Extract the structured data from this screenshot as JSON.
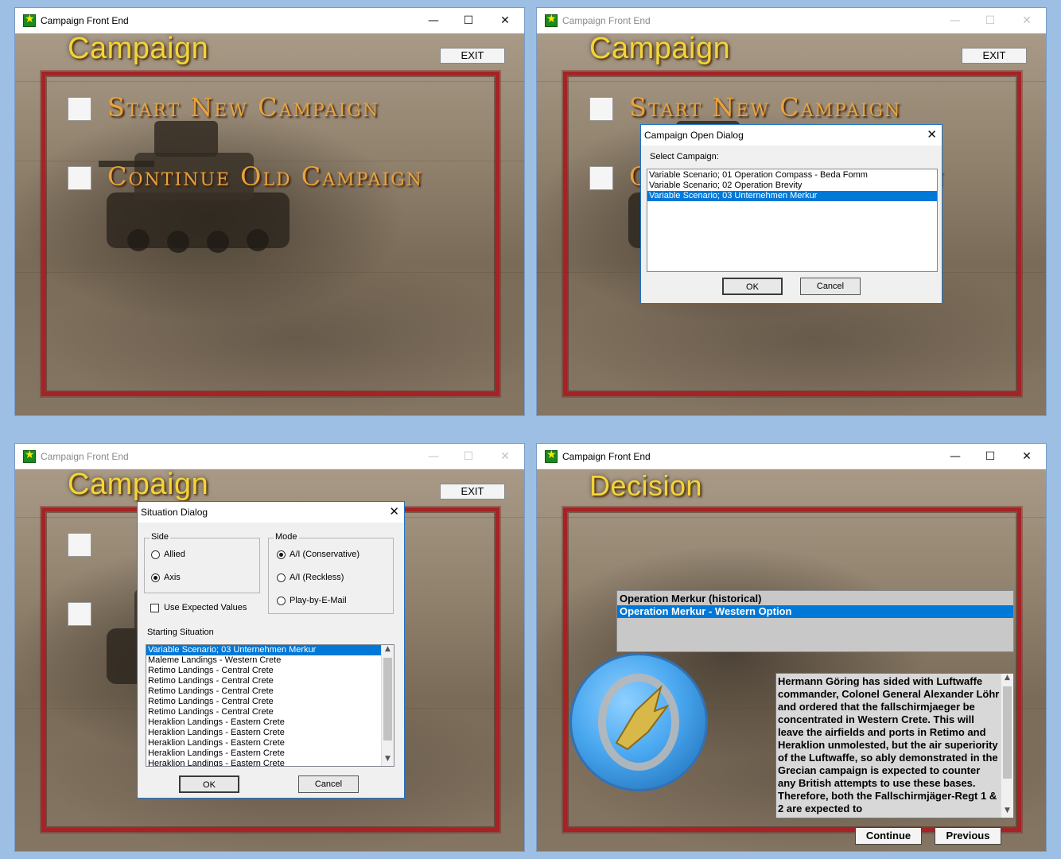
{
  "window_title": "Campaign Front End",
  "window_controls": {
    "minimize": "—",
    "maximize": "☐",
    "close": "✕"
  },
  "icons": {
    "app": "star-app-icon",
    "close": "close-icon"
  },
  "colors": {
    "heading": "#f3d43a",
    "menu_text": "#e8a33c",
    "frame": "#a52325",
    "selection": "#0078d7"
  },
  "main": {
    "heading": "Campaign",
    "exit_label": "EXIT",
    "start_new": "Start New Campaign",
    "continue_old": "Continue Old Campaign"
  },
  "open_dialog": {
    "title": "Campaign Open Dialog",
    "prompt": "Select Campaign:",
    "items": [
      "Variable Scenario; 01 Operation Compass - Beda Fomm",
      "Variable Scenario; 02 Operation Brevity",
      "Variable Scenario; 03 Unternehmen Merkur"
    ],
    "selected_index": 2,
    "ok": "OK",
    "cancel": "Cancel"
  },
  "situation_dialog": {
    "title": "Situation Dialog",
    "side_label": "Side",
    "side_options": [
      "Allied",
      "Axis"
    ],
    "side_selected": "Axis",
    "mode_label": "Mode",
    "mode_options": [
      "A/I (Conservative)",
      "A/I (Reckless)",
      "Play-by-E-Mail"
    ],
    "mode_selected": "A/I (Conservative)",
    "use_expected_values": "Use Expected Values",
    "use_expected_checked": false,
    "starting_situation_label": "Starting Situation",
    "situations": [
      "Variable Scenario; 03 Unternehmen Merkur",
      "Maleme Landings - Western Crete",
      "Retimo Landings - Central Crete",
      "Retimo Landings - Central Crete",
      "Retimo Landings - Central Crete",
      "Retimo Landings - Central Crete",
      "Retimo Landings - Central Crete",
      "Heraklion Landings - Eastern Crete",
      "Heraklion Landings - Eastern Crete",
      "Heraklion Landings - Eastern Crete",
      "Heraklion Landings - Eastern Crete",
      "Heraklion Landings - Eastern Crete"
    ],
    "situation_selected_index": 0,
    "ok": "OK",
    "cancel": "Cancel"
  },
  "decision": {
    "heading": "Decision",
    "options": [
      "Operation Merkur (historical)",
      "Operation Merkur - Western Option"
    ],
    "selected_index": 1,
    "description": "Hermann Göring has sided with Luftwaffe commander, Colonel General Alexander Löhr and ordered that the fallschirmjaeger be concentrated in Western Crete. This will leave the airfields and ports in Retimo and Heraklion unmolested, but the air superiority of the Luftwaffe, so ably demonstrated in the Grecian campaign is expected to counter any British attempts to use these bases. Therefore, both the Fallschirmjäger-Regt 1 & 2 are expected to",
    "continue": "Continue",
    "previous": "Previous",
    "badge_icon": "paratrooper-badge-icon"
  }
}
